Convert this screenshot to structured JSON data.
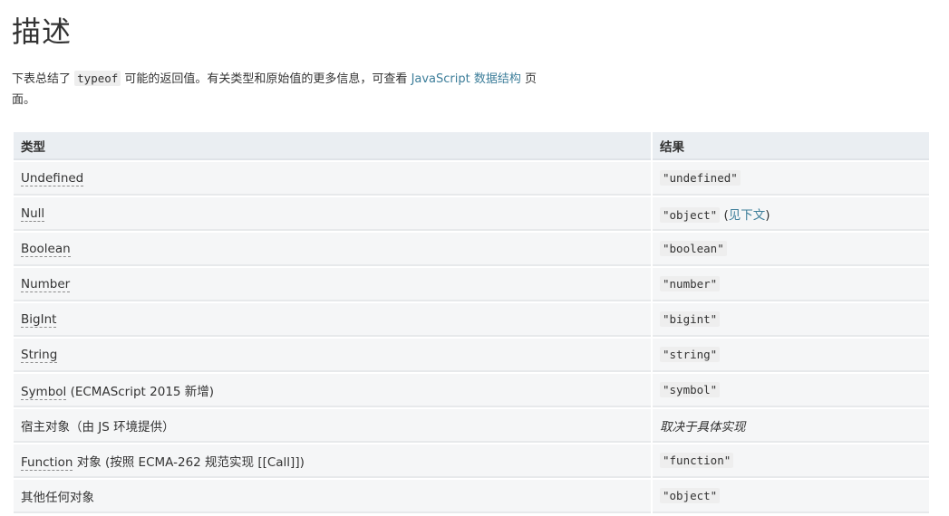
{
  "title": "描述",
  "intro": {
    "text_before": "下表总结了 ",
    "code": "typeof",
    "text_middle": " 可能的返回值。有关类型和原始值的更多信息，可查看 ",
    "link": "JavaScript 数据结构",
    "text_after": " 页面。"
  },
  "table": {
    "headers": [
      "类型",
      "结果"
    ],
    "rows": [
      {
        "type": "Undefined",
        "result_code": "\"undefined\""
      },
      {
        "type": "Null",
        "result_code": "\"object\"",
        "result_open": " (",
        "result_link": "见下文",
        "result_close": ")"
      },
      {
        "type": "Boolean",
        "result_code": "\"boolean\""
      },
      {
        "type": "Number",
        "result_code": "\"number\""
      },
      {
        "type": "BigInt",
        "result_code": "\"bigint\""
      },
      {
        "type": "String",
        "result_code": "\"string\""
      },
      {
        "type": "Symbol",
        "type_suffix": " (ECMAScript 2015 新增)",
        "result_code": "\"symbol\""
      },
      {
        "type_plain": "宿主对象（由 JS 环境提供）",
        "result_em": "取决于具体实现"
      },
      {
        "type": "Function",
        "type_suffix": " 对象 (按照 ECMA-262 规范实现 [[Call]])",
        "result_code": "\"function\""
      },
      {
        "type_plain": "其他任何对象",
        "result_code": "\"object\""
      }
    ]
  }
}
